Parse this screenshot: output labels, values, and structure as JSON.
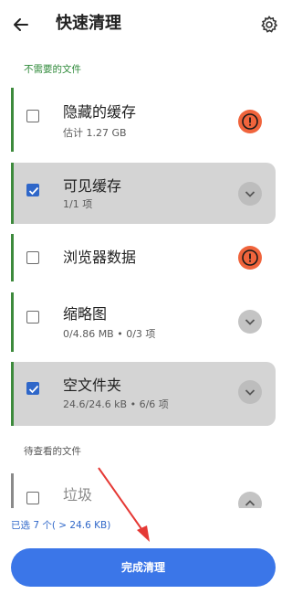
{
  "header": {
    "title": "快速清理",
    "back_icon": "arrow-left-icon",
    "settings_icon": "gear-icon"
  },
  "sections": {
    "unneeded_label": "不需要的文件",
    "review_label": "待查看的文件"
  },
  "items": [
    {
      "name": "隐藏的缓存",
      "sub": "估计 1.27 GB",
      "checked": false,
      "action_icon": "warning-icon"
    },
    {
      "name": "可见缓存",
      "sub": "1/1 项",
      "checked": true,
      "action_icon": "chevron-down-icon"
    },
    {
      "name": "浏览器数据",
      "sub": "",
      "checked": false,
      "action_icon": "warning-icon"
    },
    {
      "name": "缩略图",
      "sub": "0/4.86 MB • 0/3 项",
      "checked": false,
      "action_icon": "chevron-down-icon"
    },
    {
      "name": "空文件夹",
      "sub": "24.6/24.6 kB • 6/6 项",
      "checked": true,
      "action_icon": "chevron-down-icon"
    },
    {
      "name": "垃圾",
      "sub": "",
      "checked": false,
      "action_icon": "chevron-up-icon"
    }
  ],
  "footer": {
    "status": "已选 7 个( > 24.6 KB)",
    "finish_label": "完成清理"
  },
  "colors": {
    "accent_blue": "#3b76e8",
    "warning": "#f0643c",
    "bar_green": "#3d8a3c",
    "annotation_red": "#e53935"
  }
}
